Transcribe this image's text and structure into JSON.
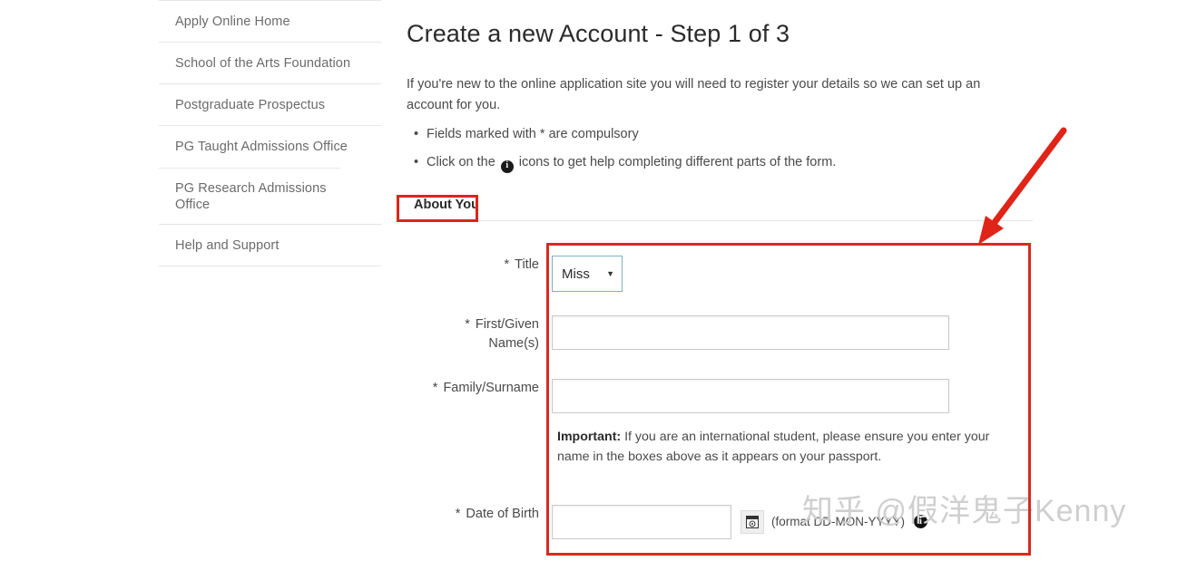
{
  "sidebar": {
    "items": [
      {
        "label": "Apply Online Home"
      },
      {
        "label": "School of the Arts Foundation"
      },
      {
        "label": "Postgraduate Prospectus"
      },
      {
        "label": "PG Taught Admissions Office"
      },
      {
        "label": "PG Research Admissions Office"
      },
      {
        "label": "Help and Support"
      }
    ]
  },
  "main": {
    "title": "Create a new Account - Step 1 of 3",
    "intro": "If you're new to the online application site you will need to register your details so we can set up an account for you.",
    "bullets": {
      "first": "Fields marked with * are compulsory",
      "second_before": "Click on the",
      "second_after": "icons to get help completing different parts of the form.",
      "info_glyph": "i"
    },
    "tab_about_you": "About You"
  },
  "form": {
    "title": {
      "label": "Title",
      "required_marker": "*",
      "value": "Miss",
      "caret": "▼"
    },
    "first_name": {
      "label": "First/Given\nName(s)",
      "required_marker": "*",
      "value": "",
      "placeholder": ""
    },
    "family_name": {
      "label": "Family/Surname",
      "required_marker": "*",
      "value": "",
      "placeholder": ""
    },
    "important_note": {
      "bold": "Important:",
      "text": " If you are an international student, please ensure you enter your name in the boxes above as it appears on your passport."
    },
    "date_of_birth": {
      "label": "Date of Birth",
      "required_marker": "*",
      "value": "",
      "placeholder": "",
      "format_hint": "(format DD-MON-YYYY)",
      "info_glyph": "i"
    }
  },
  "annotations": {
    "box_color": "#d62b1f",
    "arrow_color": "#e02418"
  },
  "watermark": {
    "text": "知乎 @假洋鬼子Kenny"
  }
}
